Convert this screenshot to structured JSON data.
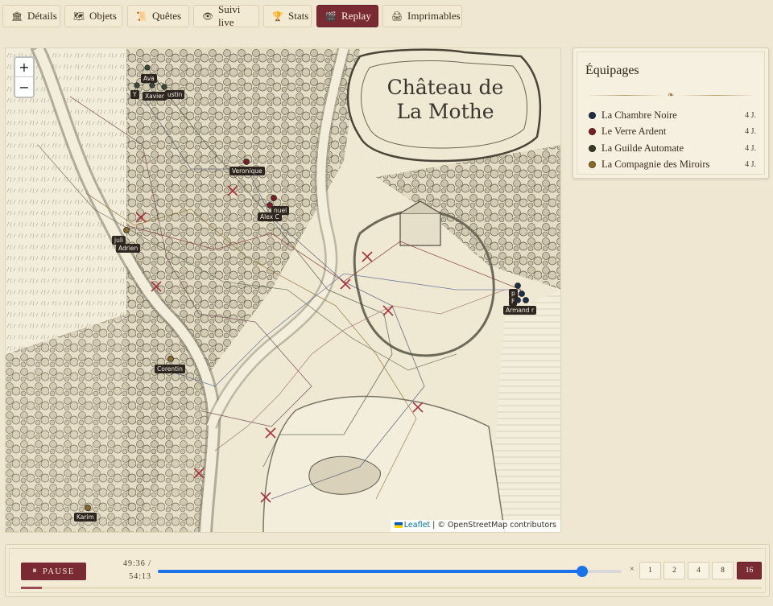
{
  "tabs": [
    {
      "label": "Détails",
      "icon": "building-icon"
    },
    {
      "label": "Objets",
      "icon": "map-icon"
    },
    {
      "label": "Quêtes",
      "icon": "scroll-icon"
    },
    {
      "label": "Suivi live",
      "icon": "eye-icon"
    },
    {
      "label": "Stats",
      "icon": "trophy-icon"
    },
    {
      "label": "Replay",
      "icon": "clapper-icon",
      "active": true
    },
    {
      "label": "Imprimables",
      "icon": "printer-icon"
    }
  ],
  "map": {
    "title_line1": "Château de",
    "title_line2": "La Mothe",
    "zoom_in": "+",
    "zoom_out": "−",
    "attribution_link": "Leaflet",
    "attribution_text": " | © OpenStreetMap contributors",
    "player_labels": [
      "Ava",
      "Y",
      "Xavier",
      "ustin",
      "Veronique",
      "nuel",
      "Alex C",
      "juli",
      "Adrien",
      "Corentin",
      "Karim",
      "p",
      "F",
      "Armand",
      "r"
    ]
  },
  "teams_panel": {
    "title": "Équipages",
    "teams": [
      {
        "name": "La Chambre Noire",
        "count": "4 J.",
        "color": "#1f2e48"
      },
      {
        "name": "Le Verre Ardent",
        "count": "4 J.",
        "color": "#7a1f24"
      },
      {
        "name": "La Guilde Automate",
        "count": "4 J.",
        "color": "#3a3a2a"
      },
      {
        "name": "La Compagnie des Miroirs",
        "count": "4 J.",
        "color": "#8a6a2a"
      }
    ]
  },
  "player": {
    "pause_label": "PAUSE",
    "time_current": "49:36 /",
    "time_total": "54:13",
    "progress": 0.9148,
    "speed_prefix": "×",
    "speeds": [
      "1",
      "2",
      "4",
      "8",
      "16"
    ],
    "active_speed": "16"
  },
  "colors": {
    "accent": "#7a2a32",
    "slider": "#1a73e8",
    "background": "#efe7d2"
  }
}
